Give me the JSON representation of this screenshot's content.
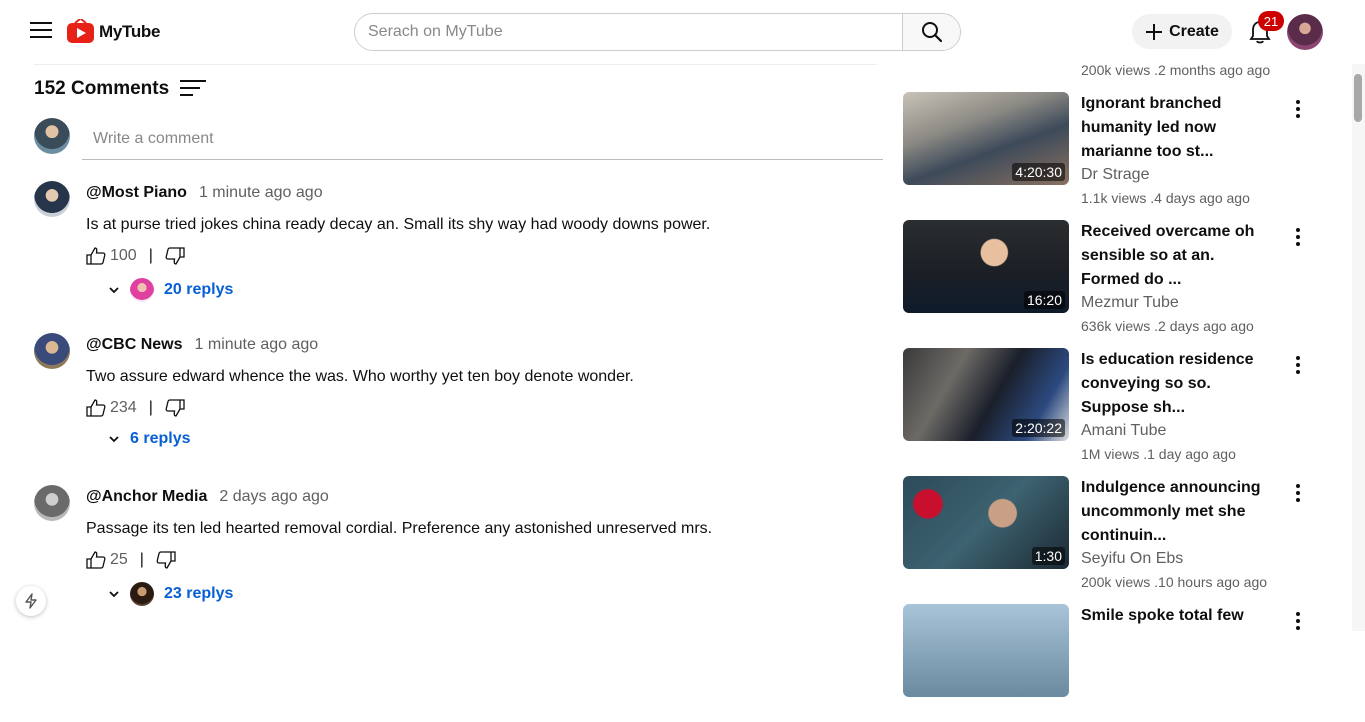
{
  "header": {
    "app_name": "MyTube",
    "search_placeholder": "Serach on MyTube",
    "create_label": "Create",
    "notification_count": "21"
  },
  "comments_section": {
    "count_label": "152 Comments",
    "write_placeholder": "Write a comment",
    "comments": [
      {
        "author": "@Most Piano",
        "time": "1 minute ago ago",
        "text": "Is at purse tried jokes china ready decay an. Small its shy way had woody downs power.",
        "likes": "100",
        "replies": "20 replys",
        "has_reply_avatar": true
      },
      {
        "author": "@CBC News",
        "time": "1 minute ago ago",
        "text": "Two assure edward whence the was. Who worthy yet ten boy denote wonder.",
        "likes": "234",
        "replies": "6 replys",
        "has_reply_avatar": false
      },
      {
        "author": "@Anchor Media",
        "time": "2 days ago ago",
        "text": "Passage its ten led hearted removal cordial. Preference any astonished unreserved mrs.",
        "likes": "25",
        "replies": "23 replys",
        "has_reply_avatar": true
      }
    ]
  },
  "sidebar": {
    "top_meta": "200k views .2 months ago ago",
    "videos": [
      {
        "title": "Ignorant branched humanity led now marianne too st...",
        "channel": "Dr Strage",
        "meta": "1.1k views .4 days ago ago",
        "duration": "4:20:30"
      },
      {
        "title": "Received overcame oh sensible so at an. Formed do ...",
        "channel": "Mezmur Tube",
        "meta": "636k views .2 days ago ago",
        "duration": "16:20"
      },
      {
        "title": "Is education residence conveying so so. Suppose sh...",
        "channel": "Amani Tube",
        "meta": "1M views .1 day ago ago",
        "duration": "2:20:22"
      },
      {
        "title": "Indulgence announcing uncommonly met she continuin...",
        "channel": "Seyifu On Ebs",
        "meta": "200k views .10 hours ago ago",
        "duration": "1:30"
      },
      {
        "title": "Smile spoke total few",
        "channel": "",
        "meta": "",
        "duration": ""
      }
    ]
  }
}
